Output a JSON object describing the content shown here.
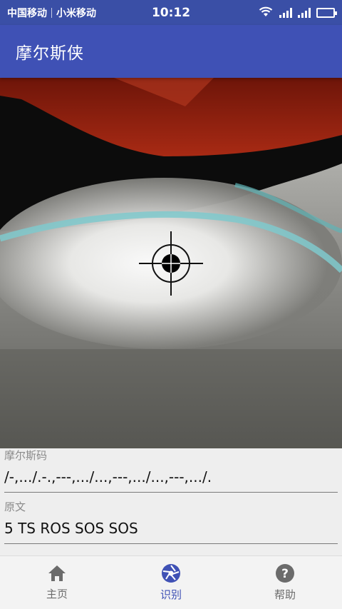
{
  "status_bar": {
    "carrier_1": "中国移动",
    "carrier_2": "小米移动",
    "time": "10:12",
    "wifi_icon": "wifi-icon",
    "signal_icon": "signal-icon",
    "battery_icon": "battery-icon"
  },
  "app_bar": {
    "title": "摩尔斯侠",
    "color": "#3f51b5"
  },
  "camera": {
    "crosshair_icon": "crosshair-icon"
  },
  "fields": {
    "morse_label": "摩尔斯码",
    "morse_value": "/-,.../.-.,---,.../...,---,.../...,---,.../.",
    "text_label": "原文",
    "text_value": "5 TS ROS SOS SOS"
  },
  "nav": {
    "items": [
      {
        "label": "主页",
        "icon": "home-icon",
        "active": false
      },
      {
        "label": "识别",
        "icon": "shutter-icon",
        "active": true
      },
      {
        "label": "帮助",
        "icon": "help-icon",
        "active": false
      }
    ],
    "active_color": "#3f51b5",
    "inactive_color": "#6b6b6b"
  }
}
